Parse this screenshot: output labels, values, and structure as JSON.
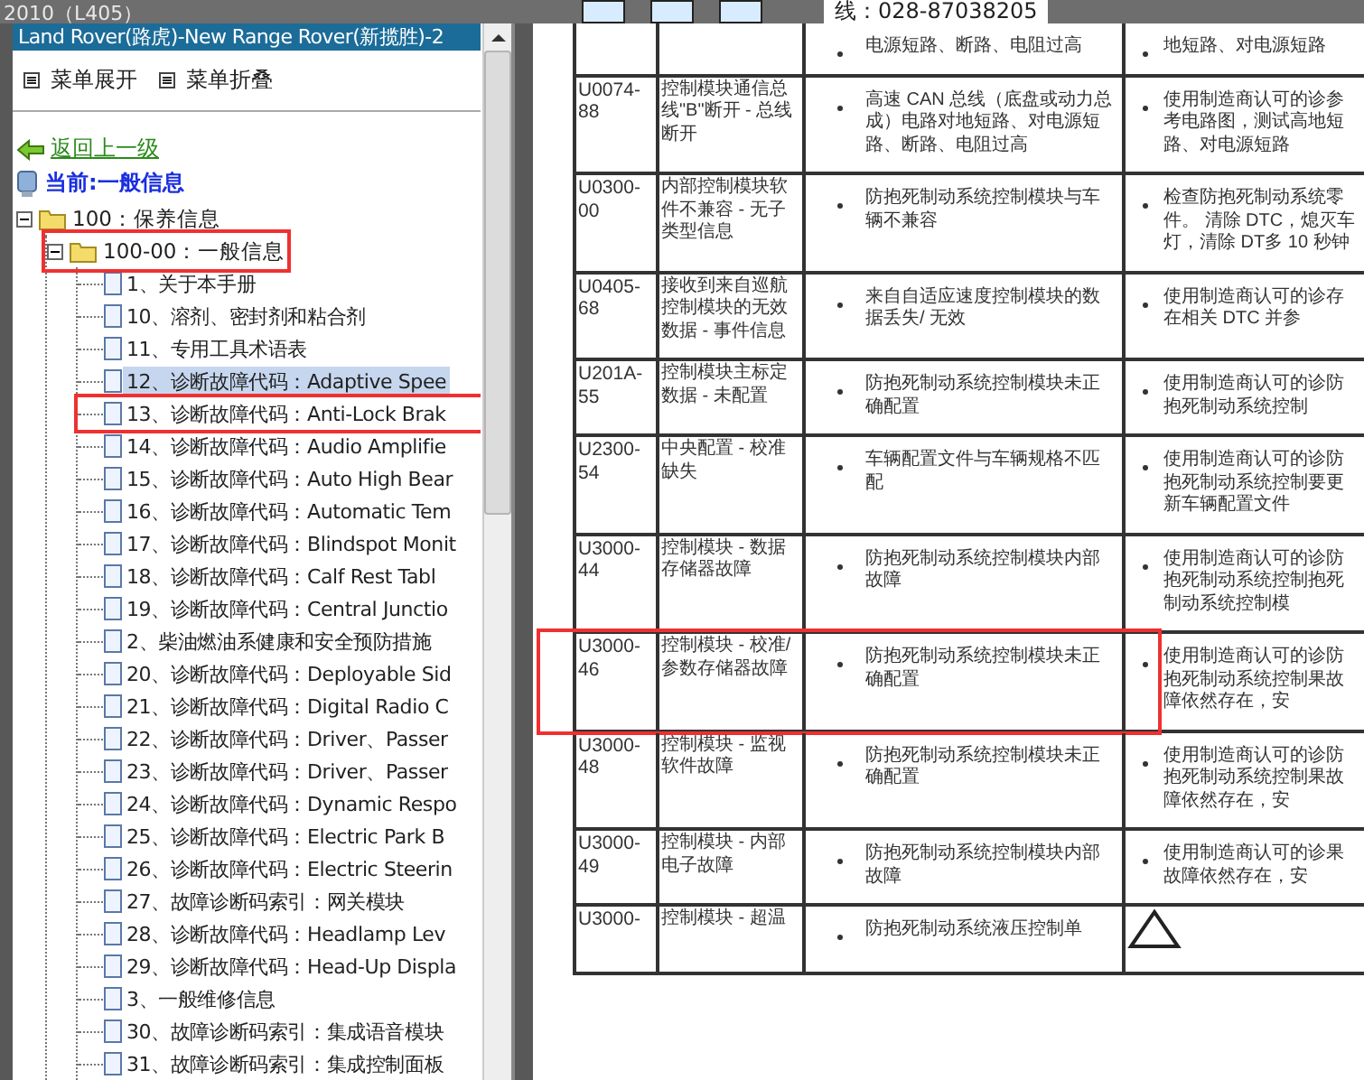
{
  "window": {
    "title": "2010（L405）"
  },
  "toolbar": {
    "phone": "线：028-87038205"
  },
  "sidebar": {
    "header": "Land Rover(路虎)-New Range Rover(新揽胜)-2",
    "menu": [
      "菜单展开",
      "菜单折叠"
    ],
    "back_link": "返回上一级",
    "current": "当前:一般信息",
    "tree": [
      {
        "label": "100：保养信息",
        "expanded": true,
        "highlighted": false,
        "children": [
          {
            "label": "100-00：一般信息",
            "expanded": true,
            "highlighted": true,
            "children": [
              {
                "label": "1、关于本手册",
                "selected": false,
                "highlighted": false
              },
              {
                "label": "10、溶剂、密封剂和粘合剂",
                "selected": false,
                "highlighted": false
              },
              {
                "label": "11、专用工具术语表",
                "selected": false,
                "highlighted": false
              },
              {
                "label": "12、诊断故障代码：Adaptive Spee",
                "selected": true,
                "highlighted": false
              },
              {
                "label": "13、诊断故障代码：Anti-Lock Brak",
                "selected": false,
                "highlighted": true
              },
              {
                "label": "14、诊断故障代码：Audio Amplifie",
                "selected": false,
                "highlighted": false
              },
              {
                "label": "15、诊断故障代码：Auto High Bear",
                "selected": false,
                "highlighted": false
              },
              {
                "label": "16、诊断故障代码：Automatic Tem",
                "selected": false,
                "highlighted": false
              },
              {
                "label": "17、诊断故障代码：Blindspot Monit",
                "selected": false,
                "highlighted": false
              },
              {
                "label": "18、诊断故障代码：Calf Rest Tabl",
                "selected": false,
                "highlighted": false
              },
              {
                "label": "19、诊断故障代码：Central Junctio",
                "selected": false,
                "highlighted": false
              },
              {
                "label": "2、柴油燃油系健康和安全预防措施",
                "selected": false,
                "highlighted": false
              },
              {
                "label": "20、诊断故障代码：Deployable Sid",
                "selected": false,
                "highlighted": false
              },
              {
                "label": "21、诊断故障代码：Digital Radio C",
                "selected": false,
                "highlighted": false
              },
              {
                "label": "22、诊断故障代码：Driver、Passer",
                "selected": false,
                "highlighted": false
              },
              {
                "label": "23、诊断故障代码：Driver、Passer",
                "selected": false,
                "highlighted": false
              },
              {
                "label": "24、诊断故障代码：Dynamic Respo",
                "selected": false,
                "highlighted": false
              },
              {
                "label": "25、诊断故障代码：Electric Park B",
                "selected": false,
                "highlighted": false
              },
              {
                "label": "26、诊断故障代码：Electric Steerin",
                "selected": false,
                "highlighted": false
              },
              {
                "label": "27、故障诊断码索引：网关模块",
                "selected": false,
                "highlighted": false
              },
              {
                "label": "28、诊断故障代码：Headlamp Lev",
                "selected": false,
                "highlighted": false
              },
              {
                "label": "29、诊断故障代码：Head-Up Displa",
                "selected": false,
                "highlighted": false
              },
              {
                "label": "3、一般维修信息",
                "selected": false,
                "highlighted": false
              },
              {
                "label": "30、故障诊断码索引：集成语音模块",
                "selected": false,
                "highlighted": false
              },
              {
                "label": "31、故障诊断码索引：集成控制面板",
                "selected": false,
                "highlighted": false
              }
            ]
          }
        ]
      }
    ]
  },
  "table": {
    "rows": [
      {
        "cause": "电源短路、断路、电阻过高",
        "action": "地短路、对电源短路",
        "highlighted": false,
        "warning": false
      },
      {
        "code": "U0074-88",
        "name": "控制模块通信总线\"B\"断开 - 总线断开",
        "cause": "高速 CAN 总线（底盘或动力总成）电路对地短路、对电源短路、断路、电阻过高",
        "action": "使用制造商认可的诊参考电路图，测试高地短路、对电源短路",
        "highlighted": false,
        "warning": false
      },
      {
        "code": "U0300-00",
        "name": "内部控制模块软件不兼容 - 无子类型信息",
        "cause": "防抱死制动系统控制模块与车辆不兼容",
        "action": "检查防抱死制动系统零件。 清除 DTC，熄灭车灯，清除 DT多 10 秒钟",
        "highlighted": false,
        "warning": false
      },
      {
        "code": "U0405-68",
        "name": "接收到来自巡航控制模块的无效数据 - 事件信息",
        "cause": "来自自适应速度控制模块的数据丢失/ 无效",
        "action": "使用制造商认可的诊存在相关 DTC 并参",
        "highlighted": false,
        "warning": false
      },
      {
        "code": "U201A-55",
        "name": "控制模块主标定数据 - 未配置",
        "cause": "防抱死制动系统控制模块未正确配置",
        "action": "使用制造商认可的诊防抱死制动系统控制",
        "highlighted": false,
        "warning": false
      },
      {
        "code": "U2300-54",
        "name": "中央配置 - 校准缺失",
        "cause": "车辆配置文件与车辆规格不匹配",
        "action": "使用制造商认可的诊防抱死制动系统控制要更新车辆配置文件",
        "highlighted": false,
        "warning": false
      },
      {
        "code": "U3000-44",
        "name": "控制模块 - 数据存储器故障",
        "cause": "防抱死制动系统控制模块内部故障",
        "action": "使用制造商认可的诊防抱死制动系统控制抱死制动系统控制模",
        "highlighted": false,
        "warning": false
      },
      {
        "code": "U3000-46",
        "name": "控制模块 - 校准/ 参数存储器故障",
        "cause": "防抱死制动系统控制模块未正确配置",
        "action": "使用制造商认可的诊防抱死制动系统控制果故障依然存在，安",
        "highlighted": true,
        "warning": false
      },
      {
        "code": "U3000-48",
        "name": "控制模块 - 监视软件故障",
        "cause": "防抱死制动系统控制模块未正确配置",
        "action": "使用制造商认可的诊防抱死制动系统控制果故障依然存在，安",
        "highlighted": false,
        "warning": false
      },
      {
        "code": "U3000-49",
        "name": "控制模块 - 内部电子故障",
        "cause": "防抱死制动系统控制模块内部故障",
        "action": "使用制造商认可的诊果故障依然存在，安",
        "highlighted": false,
        "warning": false
      },
      {
        "code": "U3000-",
        "name": "控制模块 - 超温",
        "cause": "防抱死制动系统液压控制单",
        "highlighted": false,
        "warning": true
      }
    ]
  }
}
